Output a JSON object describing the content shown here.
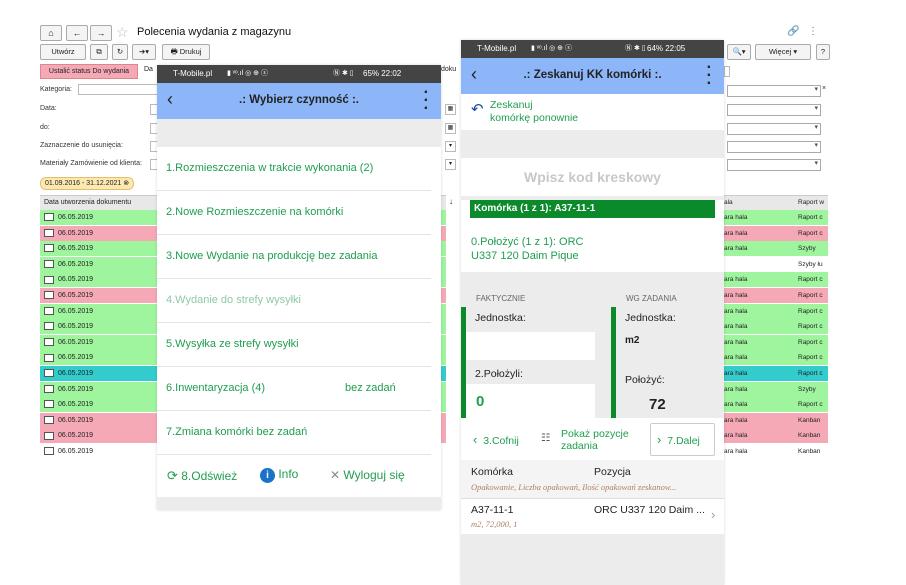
{
  "background_app": {
    "title": "Polecenia wydania z magazynu",
    "toolbar": {
      "create": "Utwórz",
      "print": "Drukuj",
      "more": "Więcej"
    },
    "status_button": "Ustalić status Do wydania",
    "status_partial": "Da",
    "right_partial": "doku",
    "filters": {
      "category": "Kategoria:",
      "date": "Data:",
      "to": "do:",
      "marked": "Zaznaczenie do usunięcia:",
      "materials": "Materiały Zamówienie od klienta:"
    },
    "date_range": "01.09.2016 - 31.12.2021",
    "column_date": "Data utworzenia dokumentu",
    "column_hall": "ala",
    "column_report": "Raport w",
    "rows": [
      {
        "date": "06.05.2019",
        "color": "#9ef59e",
        "hall": "ara hala",
        "report": "Raport c"
      },
      {
        "date": "06.05.2019",
        "color": "#f5a9b6",
        "hall": "ara hala",
        "report": "Raport c"
      },
      {
        "date": "06.05.2019",
        "color": "#9ef59e",
        "hall": "ara hala",
        "report": "Szyby"
      },
      {
        "date": "06.05.2019",
        "color": "#9ef59e",
        "hall": "",
        "report": "Szyby łu"
      },
      {
        "date": "06.05.2019",
        "color": "#9ef59e",
        "hall": "ara hala",
        "report": "Raport c"
      },
      {
        "date": "06.05.2019",
        "color": "#f5a9b6",
        "hall": "ara hala",
        "report": "Raport c"
      },
      {
        "date": "06.05.2019",
        "color": "#9ef59e",
        "hall": "ara hala",
        "report": "Raport c"
      },
      {
        "date": "06.05.2019",
        "color": "#9ef59e",
        "hall": "ara hala",
        "report": "Raport c"
      },
      {
        "date": "06.05.2019",
        "color": "#9ef59e",
        "hall": "ara hala",
        "report": "Raport c"
      },
      {
        "date": "06.05.2019",
        "color": "#9ef59e",
        "hall": "ara hala",
        "report": "Raport c"
      },
      {
        "date": "06.05.2019",
        "color": "#33cccc",
        "hall": "ara hala",
        "report": "Raport c"
      },
      {
        "date": "06.05.2019",
        "color": "#9ef59e",
        "hall": "ara hala",
        "report": "Szyby"
      },
      {
        "date": "06.05.2019",
        "color": "#9ef59e",
        "hall": "ara hala",
        "report": "Raport c"
      },
      {
        "date": "06.05.2019",
        "color": "#f5a9b6",
        "hall": "ara hala",
        "report": "Kanban"
      },
      {
        "date": "06.05.2019",
        "color": "#f5a9b6",
        "hall": "ara hala",
        "report": "Kanban"
      },
      {
        "date": "06.05.2019",
        "color": "#ffffff",
        "hall": "ara hala",
        "report": "Kanban"
      }
    ]
  },
  "phone1": {
    "status_left": "T-Mobile.pl",
    "status_right": "65%  22:02",
    "title": "Wybierz czynność",
    "items": [
      {
        "label": "1.Rozmieszczenia w trakcie wykonania (2)",
        "dim": false,
        "extra": ""
      },
      {
        "label": "2.Nowe Rozmieszczenie na komórki",
        "dim": false,
        "extra": ""
      },
      {
        "label": "3.Nowe Wydanie na produkcję bez zadania",
        "dim": false,
        "extra": ""
      },
      {
        "label": "4.Wydanie do strefy wysyłki",
        "dim": true,
        "extra": ""
      },
      {
        "label": "5.Wysyłka ze strefy wysyłki",
        "dim": false,
        "extra": ""
      },
      {
        "label": "6.Inwentaryzacja (4)",
        "dim": false,
        "extra": "bez zadań"
      },
      {
        "label": "7.Zmiana komórki bez zadań",
        "dim": false,
        "extra": ""
      }
    ],
    "footer": {
      "refresh": "8.Odśwież",
      "info": "Info",
      "logout": "Wyloguj się"
    }
  },
  "phone2": {
    "status_left": "T-Mobile.pl",
    "status_right": "64%  22:05",
    "title": "Zeskanuj KK komórki",
    "rescan_line1": "Zeskanuj",
    "rescan_line2": "komórkę ponownie",
    "barcode_placeholder": "Wpisz kod kreskowy",
    "cell_header": "Komórka (1 z 1): A37-11-1",
    "put_line1": "0.Położyć (1 z 1): ORC",
    "put_line2": "U337 120 Daim Pique",
    "actual_label": "FAKTYCZNIE",
    "task_label": "WG ZADANIA",
    "unit_label": "Jednostka:",
    "unit_task_value": "m2",
    "placed_label": "2.Położyli:",
    "placed_value": "0",
    "to_place_label": "Położyć:",
    "to_place_value": "72",
    "back_btn": "3.Cofnij",
    "show_items_line1": "Pokaż pozycje",
    "show_items_line2": "zadania",
    "next_btn": "7.Dalej",
    "table_col1": "Komórka",
    "table_col2": "Pozycja",
    "table_sub": "Opakowanie, Liczba opakowań, Ilość opakowań zeskanow...",
    "row_cell": "A37-11-1",
    "row_position": "ORC U337 120 Daim ...",
    "row_sub": "m2, 72,000, 1"
  },
  "colors": {
    "accent_green": "#1e9e4f",
    "appbar_blue": "#8cb6f8",
    "dark_green": "#0a8a2a"
  }
}
